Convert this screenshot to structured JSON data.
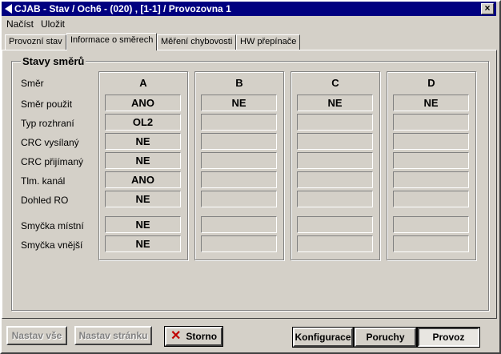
{
  "window": {
    "title": "CJAB - Stav / Och6 - (020) , [1-1] / Provozovna 1"
  },
  "menu": {
    "items": [
      "Načíst",
      "Uložit"
    ]
  },
  "tabs": [
    "Provozní stav",
    "Informace o směrech",
    "Měření chybovosti",
    "HW přepínače"
  ],
  "group": {
    "title": "Stavy směrů",
    "row_labels": [
      "Směr",
      "Směr použit",
      "Typ rozhraní",
      "CRC vysílaný",
      "CRC přijímaný",
      "Tlm. kanál",
      "Dohled RO",
      "Smyčka místní",
      "Smyčka vnější"
    ],
    "columns": [
      {
        "name": "A",
        "values": [
          "ANO",
          "OL2",
          "NE",
          "NE",
          "ANO",
          "NE",
          "NE",
          "NE"
        ]
      },
      {
        "name": "B",
        "values": [
          "NE",
          "",
          "",
          "",
          "",
          "",
          "",
          ""
        ]
      },
      {
        "name": "C",
        "values": [
          "NE",
          "",
          "",
          "",
          "",
          "",
          "",
          ""
        ]
      },
      {
        "name": "D",
        "values": [
          "NE",
          "",
          "",
          "",
          "",
          "",
          "",
          ""
        ]
      }
    ]
  },
  "buttons": {
    "set_all": "Nastav vše",
    "set_page": "Nastav stránku",
    "cancel": "Storno",
    "config": "Konfigurace",
    "faults": "Poruchy",
    "operation": "Provoz"
  },
  "colors": {
    "titlebar": "#000080",
    "face": "#d4d0c8",
    "cancel_icon": "#c00000"
  }
}
